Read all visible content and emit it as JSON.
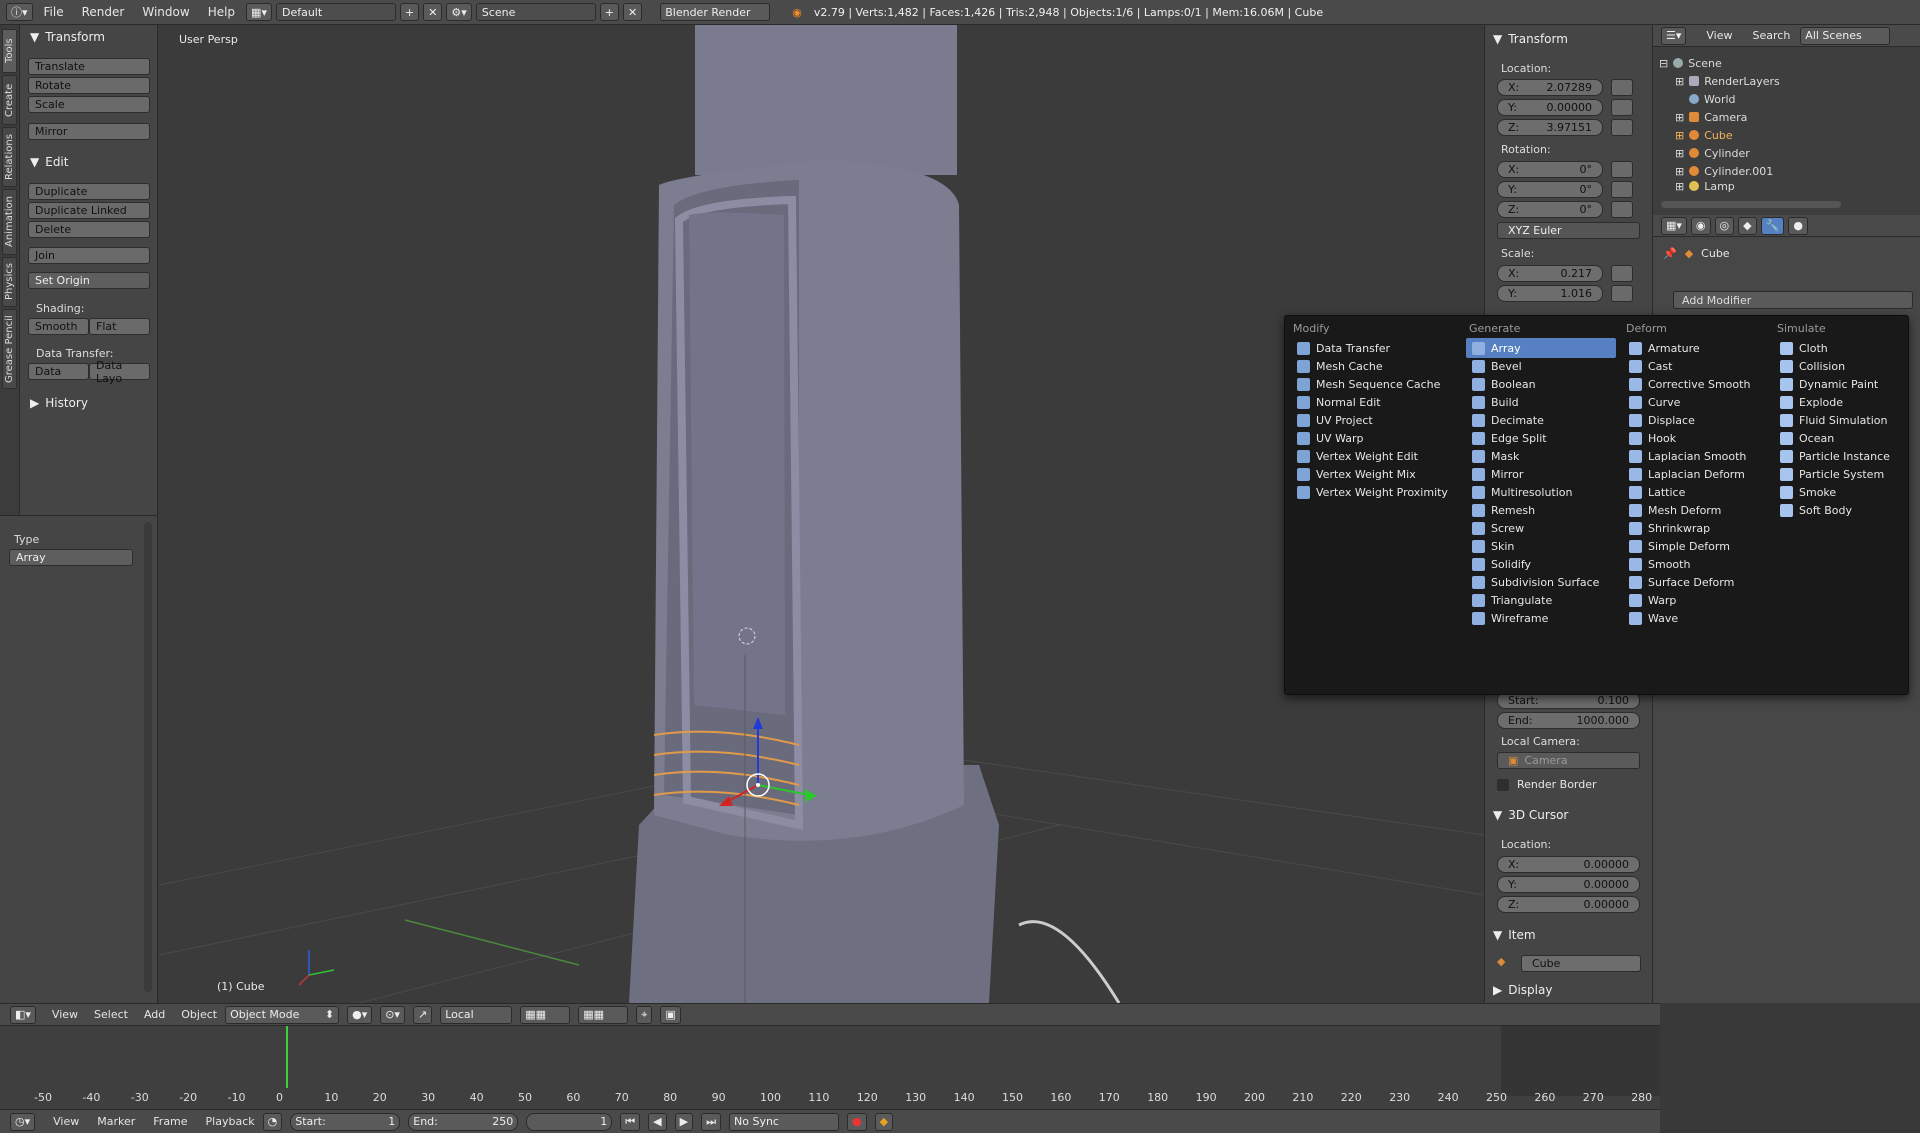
{
  "topbar": {
    "menus": [
      "File",
      "Render",
      "Window",
      "Help"
    ],
    "layout": "Default",
    "scene": "Scene",
    "engine": "Blender Render",
    "info": "v2.79 | Verts:1,482 | Faces:1,426 | Tris:2,948 | Objects:1/6 | Lamps:0/1 | Mem:16.06M | Cube"
  },
  "toolshelf": {
    "tabs": [
      "Tools",
      "Create",
      "Relations",
      "Animation",
      "Physics",
      "Grease Pencil"
    ],
    "transform_title": "Transform",
    "transform_buttons": [
      "Translate",
      "Rotate",
      "Scale",
      "Mirror"
    ],
    "edit_title": "Edit",
    "edit_buttons": [
      "Duplicate",
      "Duplicate Linked",
      "Delete",
      "Join"
    ],
    "set_origin": "Set Origin",
    "shading_label": "Shading:",
    "shading_buttons": [
      "Smooth",
      "Flat"
    ],
    "data_transfer_label": "Data Transfer:",
    "data_transfer_buttons": [
      "Data",
      "Data Layo"
    ],
    "history_title": "History",
    "type_label": "Type",
    "type_value": "Array"
  },
  "viewport": {
    "view_label": "User Persp",
    "object_label": "(1) Cube",
    "header_menus": [
      "View",
      "Select",
      "Add",
      "Object"
    ],
    "mode": "Object Mode",
    "orientation": "Local"
  },
  "npanel": {
    "transform_title": "Transform",
    "location_label": "Location:",
    "location": [
      {
        "axis": "X:",
        "value": "2.07289"
      },
      {
        "axis": "Y:",
        "value": "0.00000"
      },
      {
        "axis": "Z:",
        "value": "3.97151"
      }
    ],
    "rotation_label": "Rotation:",
    "rotation": [
      {
        "axis": "X:",
        "value": "0°"
      },
      {
        "axis": "Y:",
        "value": "0°"
      },
      {
        "axis": "Z:",
        "value": "0°"
      }
    ],
    "rotation_mode": "XYZ Euler",
    "scale_label": "Scale:",
    "scale": [
      {
        "axis": "X:",
        "value": "0.217"
      },
      {
        "axis": "Y:",
        "value": "1.016"
      }
    ],
    "clip": [
      {
        "axis": "Start:",
        "value": "0.100"
      },
      {
        "axis": "End:",
        "value": "1000.000"
      }
    ],
    "local_camera_label": "Local Camera:",
    "local_camera": "Camera",
    "render_border": "Render Border",
    "cursor_title": "3D Cursor",
    "cursor_location_label": "Location:",
    "cursor": [
      {
        "axis": "X:",
        "value": "0.00000"
      },
      {
        "axis": "Y:",
        "value": "0.00000"
      },
      {
        "axis": "Z:",
        "value": "0.00000"
      }
    ],
    "item_title": "Item",
    "item_name": "Cube",
    "display_title": "Display"
  },
  "outliner": {
    "menus": [
      "View",
      "Search"
    ],
    "filter": "All Scenes",
    "rows": [
      "Scene",
      "RenderLayers",
      "World",
      "Camera",
      "Cube",
      "Cylinder",
      "Cylinder.001",
      "Lamp"
    ]
  },
  "properties": {
    "object_name": "Cube",
    "add_modifier": "Add Modifier"
  },
  "modifier_menu": {
    "columns": [
      {
        "title": "Modify",
        "items": [
          "Data Transfer",
          "Mesh Cache",
          "Mesh Sequence Cache",
          "Normal Edit",
          "UV Project",
          "UV Warp",
          "Vertex Weight Edit",
          "Vertex Weight Mix",
          "Vertex Weight Proximity"
        ]
      },
      {
        "title": "Generate",
        "items": [
          "Array",
          "Bevel",
          "Boolean",
          "Build",
          "Decimate",
          "Edge Split",
          "Mask",
          "Mirror",
          "Multiresolution",
          "Remesh",
          "Screw",
          "Skin",
          "Solidify",
          "Subdivision Surface",
          "Triangulate",
          "Wireframe"
        ]
      },
      {
        "title": "Deform",
        "items": [
          "Armature",
          "Cast",
          "Corrective Smooth",
          "Curve",
          "Displace",
          "Hook",
          "Laplacian Smooth",
          "Laplacian Deform",
          "Lattice",
          "Mesh Deform",
          "Shrinkwrap",
          "Simple Deform",
          "Smooth",
          "Surface Deform",
          "Warp",
          "Wave"
        ]
      },
      {
        "title": "Simulate",
        "items": [
          "Cloth",
          "Collision",
          "Dynamic Paint",
          "Explode",
          "Fluid Simulation",
          "Ocean",
          "Particle Instance",
          "Particle System",
          "Smoke",
          "Soft Body"
        ]
      }
    ],
    "highlighted": "Array"
  },
  "timeline": {
    "ticks": [
      "-50",
      "-40",
      "-30",
      "-20",
      "-10",
      "0",
      "10",
      "20",
      "30",
      "40",
      "50",
      "60",
      "70",
      "80",
      "90",
      "100",
      "110",
      "120",
      "130",
      "140",
      "150",
      "160",
      "170",
      "180",
      "190",
      "200",
      "210",
      "220",
      "230",
      "240",
      "250",
      "260",
      "270",
      "280"
    ],
    "menus": [
      "View",
      "Marker",
      "Frame",
      "Playback"
    ],
    "start_label": "Start:",
    "start": "1",
    "end_label": "End:",
    "end": "250",
    "current": "1",
    "sync": "No Sync"
  }
}
